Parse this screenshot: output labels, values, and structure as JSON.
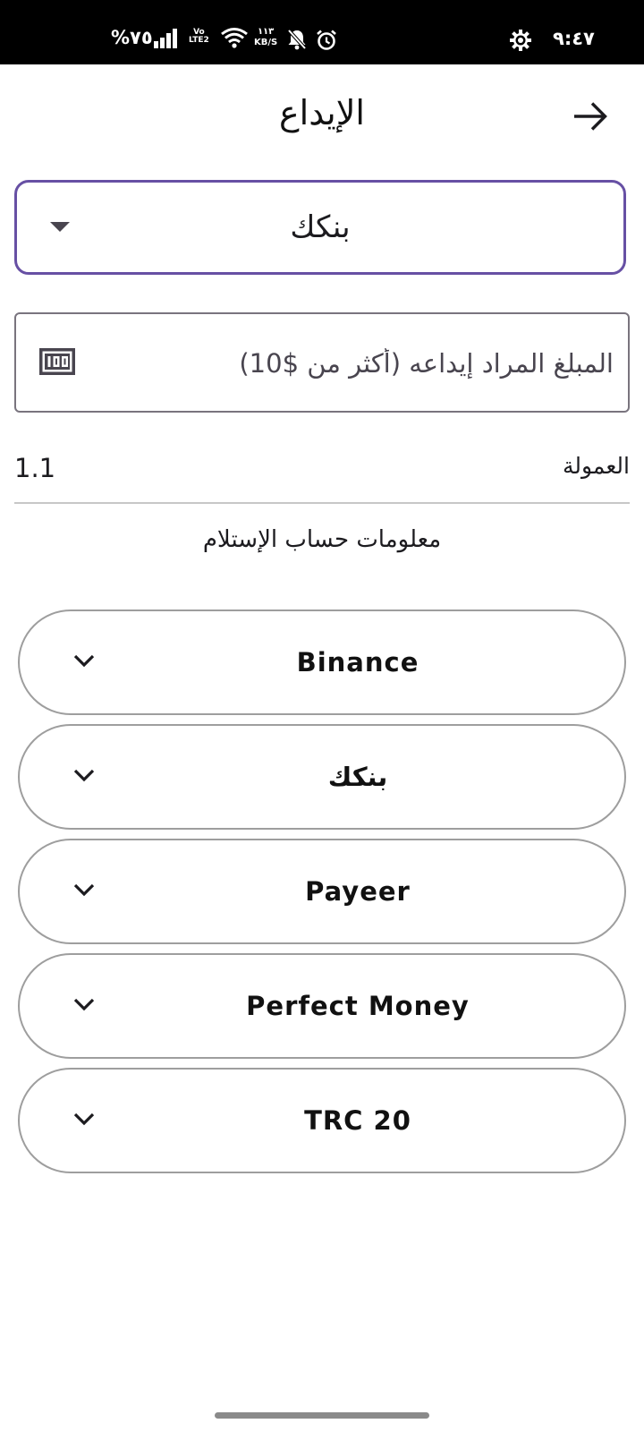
{
  "status_bar": {
    "battery": "%٧٥",
    "network_type_line1": "Vo",
    "network_type_line2": "LTE2",
    "speed_value": "١١٣",
    "speed_unit": "KB/S",
    "time": "٩:٤٧"
  },
  "header": {
    "title": "الإيداع",
    "back_icon": "arrow-right-icon"
  },
  "method_select": {
    "value": "بنكك",
    "icon": "dropdown-arrow-icon"
  },
  "amount": {
    "placeholder": "المبلغ المراد إيداعه (أكثر من $10)",
    "value": "",
    "icon": "money-icon"
  },
  "commission": {
    "label": "العمولة",
    "value": "1.1"
  },
  "receiving": {
    "heading": "معلومات حساب الإستلام",
    "accounts": [
      {
        "name": "Binance"
      },
      {
        "name": "بنكك"
      },
      {
        "name": "Payeer"
      },
      {
        "name": "Perfect Money"
      },
      {
        "name": "TRC 20"
      }
    ]
  },
  "colors": {
    "select_border": "#6750a4",
    "outline": "#79747e",
    "status_bar_bg": "#000000"
  }
}
